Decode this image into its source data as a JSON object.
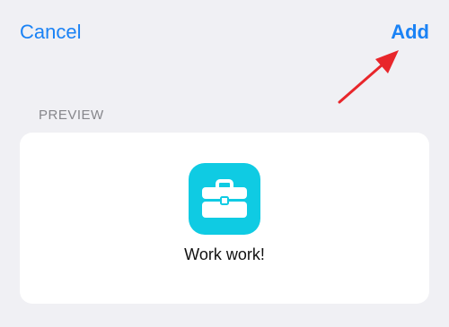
{
  "nav": {
    "cancel_label": "Cancel",
    "add_label": "Add"
  },
  "preview": {
    "section_title": "PREVIEW",
    "shortcut_name": "Work work!",
    "icon": "briefcase-icon"
  },
  "colors": {
    "accent": "#1a82f5",
    "background": "#f0f0f4",
    "icon_bg": "#0fcbe3",
    "annotation_arrow": "#e8262b"
  }
}
